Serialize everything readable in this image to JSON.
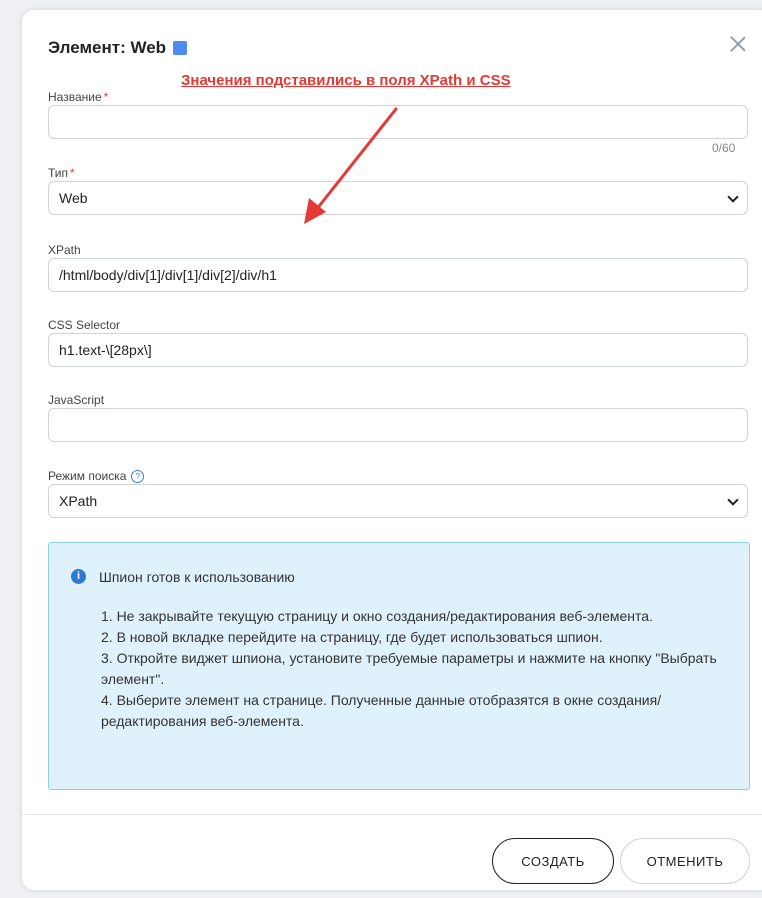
{
  "modal": {
    "title": "Элемент: Web",
    "title_square_color": "#4d8bf0"
  },
  "annotation": {
    "text": "Значения подставились в поля XPath и CSS",
    "color": "#e53935"
  },
  "form": {
    "name": {
      "label": "Название",
      "required_mark": "*",
      "value": "",
      "counter": "0/60"
    },
    "type": {
      "label": "Тип",
      "required_mark": "*",
      "value": "Web"
    },
    "xpath": {
      "label": "XPath",
      "value": "/html/body/div[1]/div[1]/div[2]/div/h1"
    },
    "css": {
      "label": "CSS Selector",
      "value": "h1.text-\\[28px\\]"
    },
    "js": {
      "label": "JavaScript",
      "value": ""
    },
    "mode": {
      "label": "Режим поиска",
      "help_glyph": "?",
      "value": "XPath"
    }
  },
  "info": {
    "icon_glyph": "i",
    "title": "Шпион готов к использованию",
    "items": [
      "1. Не закрывайте текущую страницу и окно создания/редактирования веб-элемента.",
      "2. В новой вкладке перейдите на страницу, где будет использоваться шпион.",
      "3. Откройте виджет шпиона, установите требуемые параметры и нажмите на кнопку \"Выбрать элемент\".",
      "4. Выберите элемент на странице. Полученные данные отобразятся в окне создания/редактирования веб-элемента."
    ]
  },
  "buttons": {
    "create": "СОЗДАТЬ",
    "cancel": "ОТМЕНИТЬ"
  }
}
